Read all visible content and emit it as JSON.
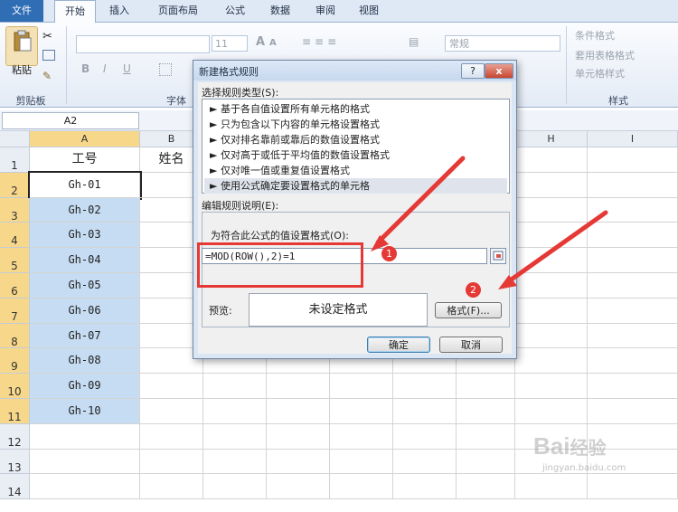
{
  "ribbon": {
    "tabs": [
      "文件",
      "开始",
      "插入",
      "页面布局",
      "公式",
      "数据",
      "审阅",
      "视图"
    ],
    "paste_label": "粘贴",
    "clipboard_group": "剪贴板",
    "font_group": "字体",
    "styles_group": "样式",
    "font_size": "11",
    "number_format": "常规",
    "bold": "B",
    "italic": "I",
    "underline": "U",
    "grow_font": "A",
    "shrink_font": "A",
    "styles_items": [
      "条件格式",
      "套用表格格式",
      "单元格样式"
    ]
  },
  "formula_bar": {
    "name_box": "A2"
  },
  "sheet": {
    "columns": [
      "A",
      "B",
      "H",
      "I"
    ],
    "rows": [
      "1",
      "2",
      "3",
      "4",
      "5",
      "6",
      "7",
      "8",
      "9",
      "10",
      "11",
      "12",
      "13",
      "14"
    ],
    "header_a": "工号",
    "header_b": "姓名",
    "a_values": [
      "Gh-01",
      "Gh-02",
      "Gh-03",
      "Gh-04",
      "Gh-05",
      "Gh-06",
      "Gh-07",
      "Gh-08",
      "Gh-09",
      "Gh-10"
    ]
  },
  "dialog": {
    "title": "新建格式规则",
    "help": "?",
    "close": "x",
    "select_type_label": "选择规则类型(S):",
    "rules": [
      "► 基于各自值设置所有单元格的格式",
      "► 只为包含以下内容的单元格设置格式",
      "► 仅对排名靠前或靠后的数值设置格式",
      "► 仅对高于或低于平均值的数值设置格式",
      "► 仅对唯一值或重复值设置格式",
      "► 使用公式确定要设置格式的单元格"
    ],
    "edit_label": "编辑规则说明(E):",
    "formula_label": "为符合此公式的值设置格式(O):",
    "formula_value": "=MOD(ROW(),2)=1",
    "preview_label": "预览:",
    "preview_text": "未设定格式",
    "format_button": "格式(F)...",
    "ok_button": "确定",
    "cancel_button": "取消"
  },
  "annotations": {
    "badge1": "1",
    "badge2": "2",
    "accent": "#e53935"
  },
  "watermark": {
    "brand": "Bai",
    "brand2": "经验",
    "url": "jingyan.baidu.com"
  }
}
